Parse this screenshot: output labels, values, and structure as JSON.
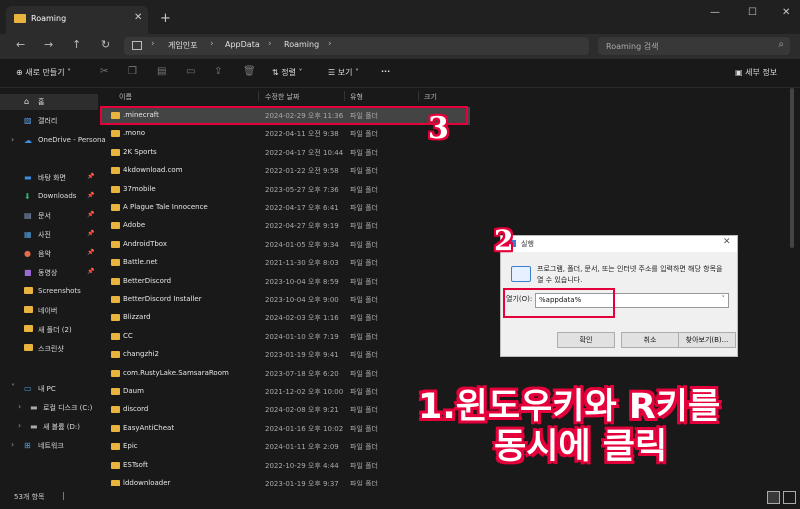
{
  "window": {
    "tab_title": "Roaming",
    "close_glyph": "✕",
    "new_tab_glyph": "+",
    "minimize": "—",
    "maximize": "☐",
    "close": "✕"
  },
  "nav": {
    "back": "←",
    "forward": "→",
    "up": "↑",
    "refresh": "↻",
    "breadcrumbs": [
      "게임인포",
      "AppData",
      "Roaming"
    ],
    "search_placeholder": "Roaming 검색"
  },
  "toolbar": {
    "new_label": "새로 만들기",
    "sort_label": "정렬",
    "view_label": "보기",
    "more_label": "···",
    "details_label": "세부 정보"
  },
  "sidebar": {
    "items": [
      {
        "label": "홈",
        "icon": "home-icon"
      },
      {
        "label": "갤러리",
        "icon": "gallery-icon"
      },
      {
        "label": "OneDrive - Persona",
        "icon": "cloud-icon"
      },
      {
        "label": "바탕 화면",
        "icon": "desktop-icon"
      },
      {
        "label": "Downloads",
        "icon": "download-icon"
      },
      {
        "label": "문서",
        "icon": "document-icon"
      },
      {
        "label": "사진",
        "icon": "picture-icon"
      },
      {
        "label": "음악",
        "icon": "music-icon"
      },
      {
        "label": "동영상",
        "icon": "video-icon"
      },
      {
        "label": "Screenshots",
        "icon": "folder-icon"
      },
      {
        "label": "네이버",
        "icon": "folder-icon"
      },
      {
        "label": "새 폴더 (2)",
        "icon": "folder-icon"
      },
      {
        "label": "스크린샷",
        "icon": "folder-icon"
      },
      {
        "label": "내 PC",
        "icon": "pc-icon"
      },
      {
        "label": "로컬 디스크 (C:)",
        "icon": "drive-icon"
      },
      {
        "label": "새 볼륨 (D:)",
        "icon": "drive-icon"
      },
      {
        "label": "네트워크",
        "icon": "network-icon"
      }
    ]
  },
  "list": {
    "columns": [
      "이름",
      "수정한 날짜",
      "유형",
      "크기"
    ],
    "rows": [
      {
        "name": ".minecraft",
        "date": "2024-02-29 오후 11:36",
        "type": "파일 폴더"
      },
      {
        "name": ".mono",
        "date": "2022-04-11 오전 9:38",
        "type": "파일 폴더"
      },
      {
        "name": "2K Sports",
        "date": "2022-04-17 오전 10:44",
        "type": "파일 폴더"
      },
      {
        "name": "4kdownload.com",
        "date": "2022-01-22 오전 9:58",
        "type": "파일 폴더"
      },
      {
        "name": "37mobile",
        "date": "2023-05-27 오후 7:36",
        "type": "파일 폴더"
      },
      {
        "name": "A Plague Tale Innocence",
        "date": "2022-04-17 오후 6:41",
        "type": "파일 폴더"
      },
      {
        "name": "Adobe",
        "date": "2022-04-27 오후 9:19",
        "type": "파일 폴더"
      },
      {
        "name": "AndroidTbox",
        "date": "2024-01-05 오후 9:34",
        "type": "파일 폴더"
      },
      {
        "name": "Battle.net",
        "date": "2021-11-30 오후 8:03",
        "type": "파일 폴더"
      },
      {
        "name": "BetterDiscord",
        "date": "2023-10-04 오후 8:59",
        "type": "파일 폴더"
      },
      {
        "name": "BetterDiscord Installer",
        "date": "2023-10-04 오후 9:00",
        "type": "파일 폴더"
      },
      {
        "name": "Blizzard",
        "date": "2024-02-03 오후 1:16",
        "type": "파일 폴더"
      },
      {
        "name": "CC",
        "date": "2024-01-10 오후 7:19",
        "type": "파일 폴더"
      },
      {
        "name": "changzhi2",
        "date": "2023-01-19 오후 9:41",
        "type": "파일 폴더"
      },
      {
        "name": "com.RustyLake.SamsaraRoom",
        "date": "2023-07-18 오후 6:20",
        "type": "파일 폴더"
      },
      {
        "name": "Daum",
        "date": "2021-12-02 오후 10:00",
        "type": "파일 폴더"
      },
      {
        "name": "discord",
        "date": "2024-02-08 오후 9:21",
        "type": "파일 폴더"
      },
      {
        "name": "EasyAntiCheat",
        "date": "2024-01-16 오후 10:02",
        "type": "파일 폴더"
      },
      {
        "name": "Epic",
        "date": "2024-01-11 오후 2:09",
        "type": "파일 폴더"
      },
      {
        "name": "ESTsoft",
        "date": "2022-10-29 오후 4:44",
        "type": "파일 폴더"
      },
      {
        "name": "lddownloader",
        "date": "2023-01-19 오후 9:37",
        "type": "파일 폴더"
      }
    ]
  },
  "status": {
    "count": "53개 항목"
  },
  "run_dialog": {
    "title": "실행",
    "description": "프로그램, 폴더, 문서, 또는 인터넷 주소를 입력하면 해당 항목을 열 수 있습니다.",
    "open_label": "열기(O):",
    "input_value": "%appdata%",
    "ok": "확인",
    "cancel": "취소",
    "browse": "찾아보기(B)..."
  },
  "annotations": {
    "step3": "3",
    "step2": "2",
    "caption_line1": "1.윈도우키와 R키를",
    "caption_line2": "동시에 클릭",
    "highlight_color": "#e4003a"
  },
  "colors": {
    "folder": "#e8b43d",
    "accent": "#e4003a"
  }
}
